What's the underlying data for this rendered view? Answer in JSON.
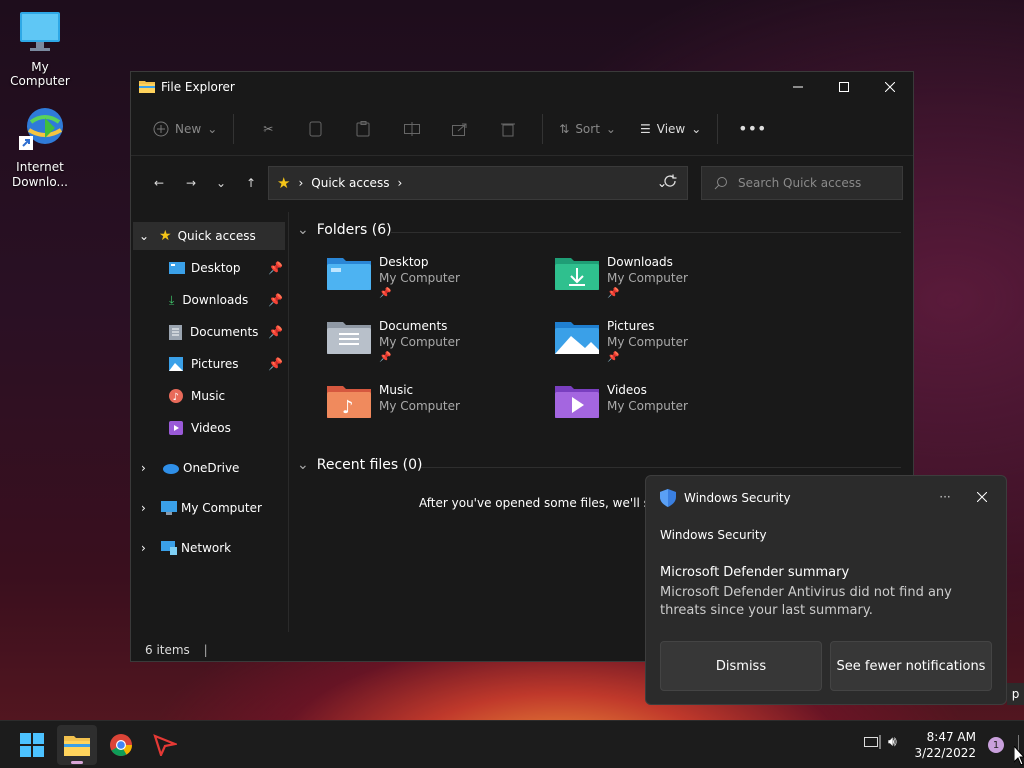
{
  "desktop": {
    "icons": [
      {
        "label": "My Computer",
        "icon": "monitor-icon"
      },
      {
        "label": "Internet Downlo...",
        "icon": "idm-icon"
      }
    ]
  },
  "window": {
    "title": "File Explorer",
    "toolbar": {
      "new_label": "New",
      "sort_label": "Sort",
      "view_label": "View"
    },
    "address": {
      "crumb": "Quick access"
    },
    "search": {
      "placeholder": "Search Quick access"
    },
    "sidebar": {
      "quick_access": "Quick access",
      "items": [
        "Desktop",
        "Downloads",
        "Documents",
        "Pictures",
        "Music",
        "Videos"
      ],
      "onedrive": "OneDrive",
      "my_computer": "My Computer",
      "network": "Network"
    },
    "content": {
      "folders_header": "Folders (6)",
      "folders": [
        {
          "name": "Desktop",
          "location": "My Computer"
        },
        {
          "name": "Downloads",
          "location": "My Computer"
        },
        {
          "name": "Documents",
          "location": "My Computer"
        },
        {
          "name": "Pictures",
          "location": "My Computer"
        },
        {
          "name": "Music",
          "location": "My Computer"
        },
        {
          "name": "Videos",
          "location": "My Computer"
        }
      ],
      "recent_header": "Recent files (0)",
      "recent_empty": "After you've opened some files, we'll show"
    },
    "status": "6 items"
  },
  "toast": {
    "app": "Windows Security",
    "source": "Windows Security",
    "heading": "Microsoft Defender summary",
    "body": "Microsoft Defender Antivirus did not find any threats since your last summary.",
    "dismiss": "Dismiss",
    "fewer": "See fewer notifications",
    "peek_char": "p"
  },
  "taskbar": {
    "time": "8:47 AM",
    "date": "3/22/2022",
    "badge": "1"
  },
  "colors": {
    "folder_blue": "#3aa0e8",
    "folder_yellow": "#f2c14e",
    "accent": "#4cc2ff"
  }
}
